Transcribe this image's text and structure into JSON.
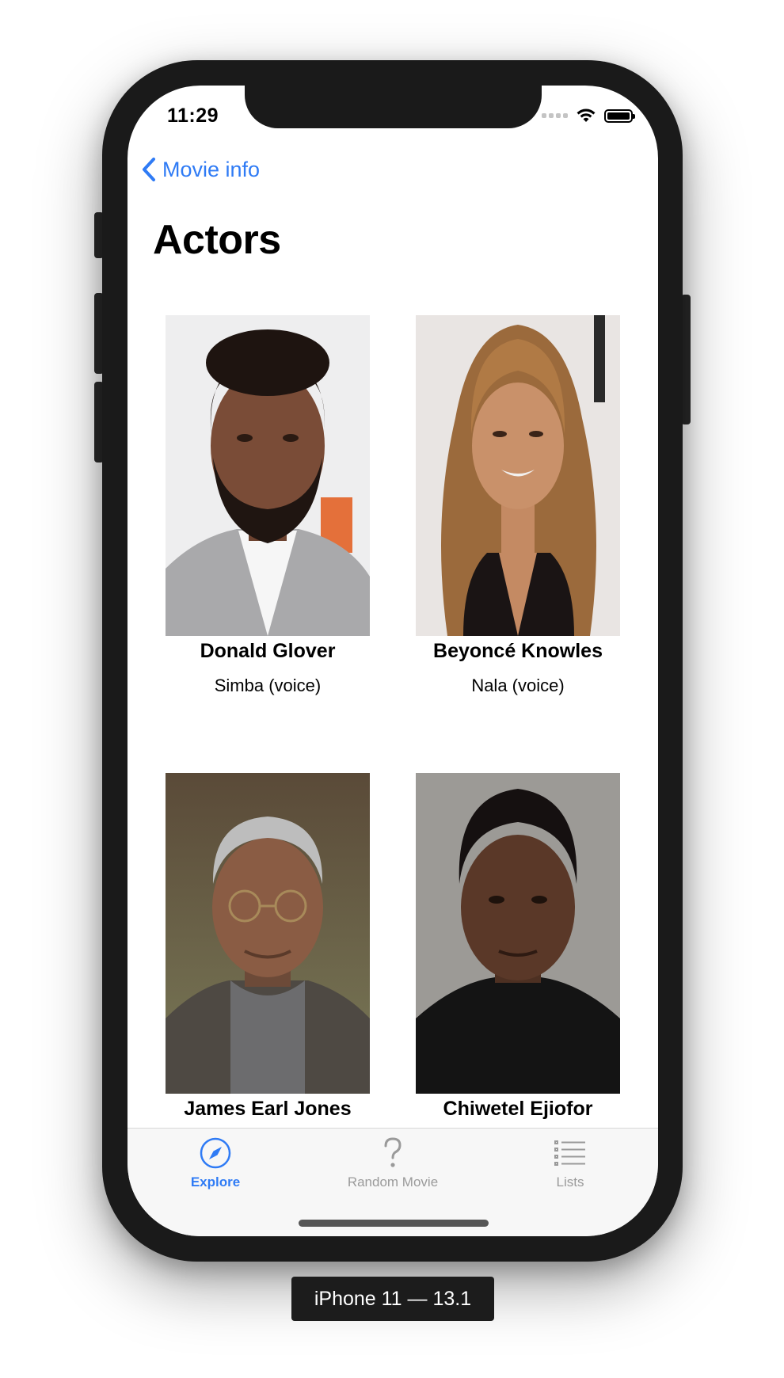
{
  "status_bar": {
    "time": "11:29"
  },
  "nav": {
    "back_label": "Movie info",
    "title": "Actors"
  },
  "actors": [
    {
      "name": "Donald Glover",
      "role": "Simba (voice)"
    },
    {
      "name": "Beyoncé Knowles",
      "role": "Nala (voice)"
    },
    {
      "name": "James Earl Jones",
      "role": ""
    },
    {
      "name": "Chiwetel Ejiofor",
      "role": ""
    }
  ],
  "tab_bar": {
    "items": [
      {
        "label": "Explore",
        "icon": "compass-icon",
        "active": true
      },
      {
        "label": "Random Movie",
        "icon": "question-mark-icon",
        "active": false
      },
      {
        "label": "Lists",
        "icon": "list-icon",
        "active": false
      }
    ]
  },
  "device_label": "iPhone 11 — 13.1",
  "colors": {
    "accent": "#2f7bf5",
    "tab_inactive": "#9a9a9a",
    "device_frame": "#1a1a1a"
  }
}
